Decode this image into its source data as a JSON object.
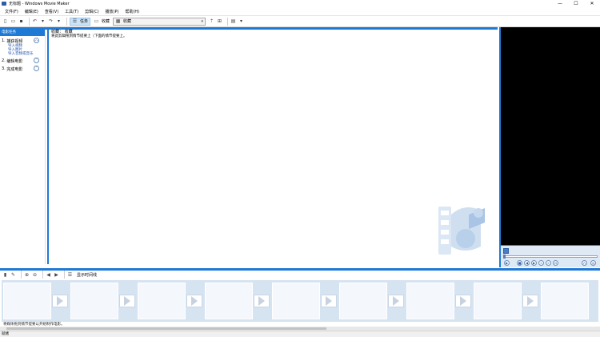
{
  "window": {
    "title": "无标题 - Windows Movie Maker",
    "controls": [
      "—",
      "☐",
      "✕"
    ]
  },
  "menu": [
    "文件(F)",
    "编辑(E)",
    "查看(V)",
    "工具(T)",
    "剪辑(C)",
    "播放(P)",
    "帮助(H)"
  ],
  "toolbar": {
    "tasks_label": "任务",
    "collections_label": "收藏",
    "collection_combo": "收藏"
  },
  "taskpane": {
    "header": "电影任务",
    "sections": [
      {
        "number": "1.",
        "title": "捕获视频",
        "links": [
          "导入视频",
          "导入图片",
          "导入音频或音乐"
        ]
      },
      {
        "number": "2.",
        "title": "编辑电影",
        "links": []
      },
      {
        "number": "3.",
        "title": "完成电影",
        "links": []
      }
    ]
  },
  "collection": {
    "title": "收藏： 收藏",
    "hint": "将此剪辑拖到情节提要上（下面的情节提要上。"
  },
  "storyboard": {
    "show_timeline_label": "显示时间线",
    "hint": "将媒体拖到情节提要以开始制作电影。",
    "frame_count": 9
  },
  "status": {
    "text": "就绪"
  },
  "colors": {
    "accent": "#1f7ad6",
    "link": "#1a4fb0",
    "storyboard_bg": "#d6e3f1"
  }
}
